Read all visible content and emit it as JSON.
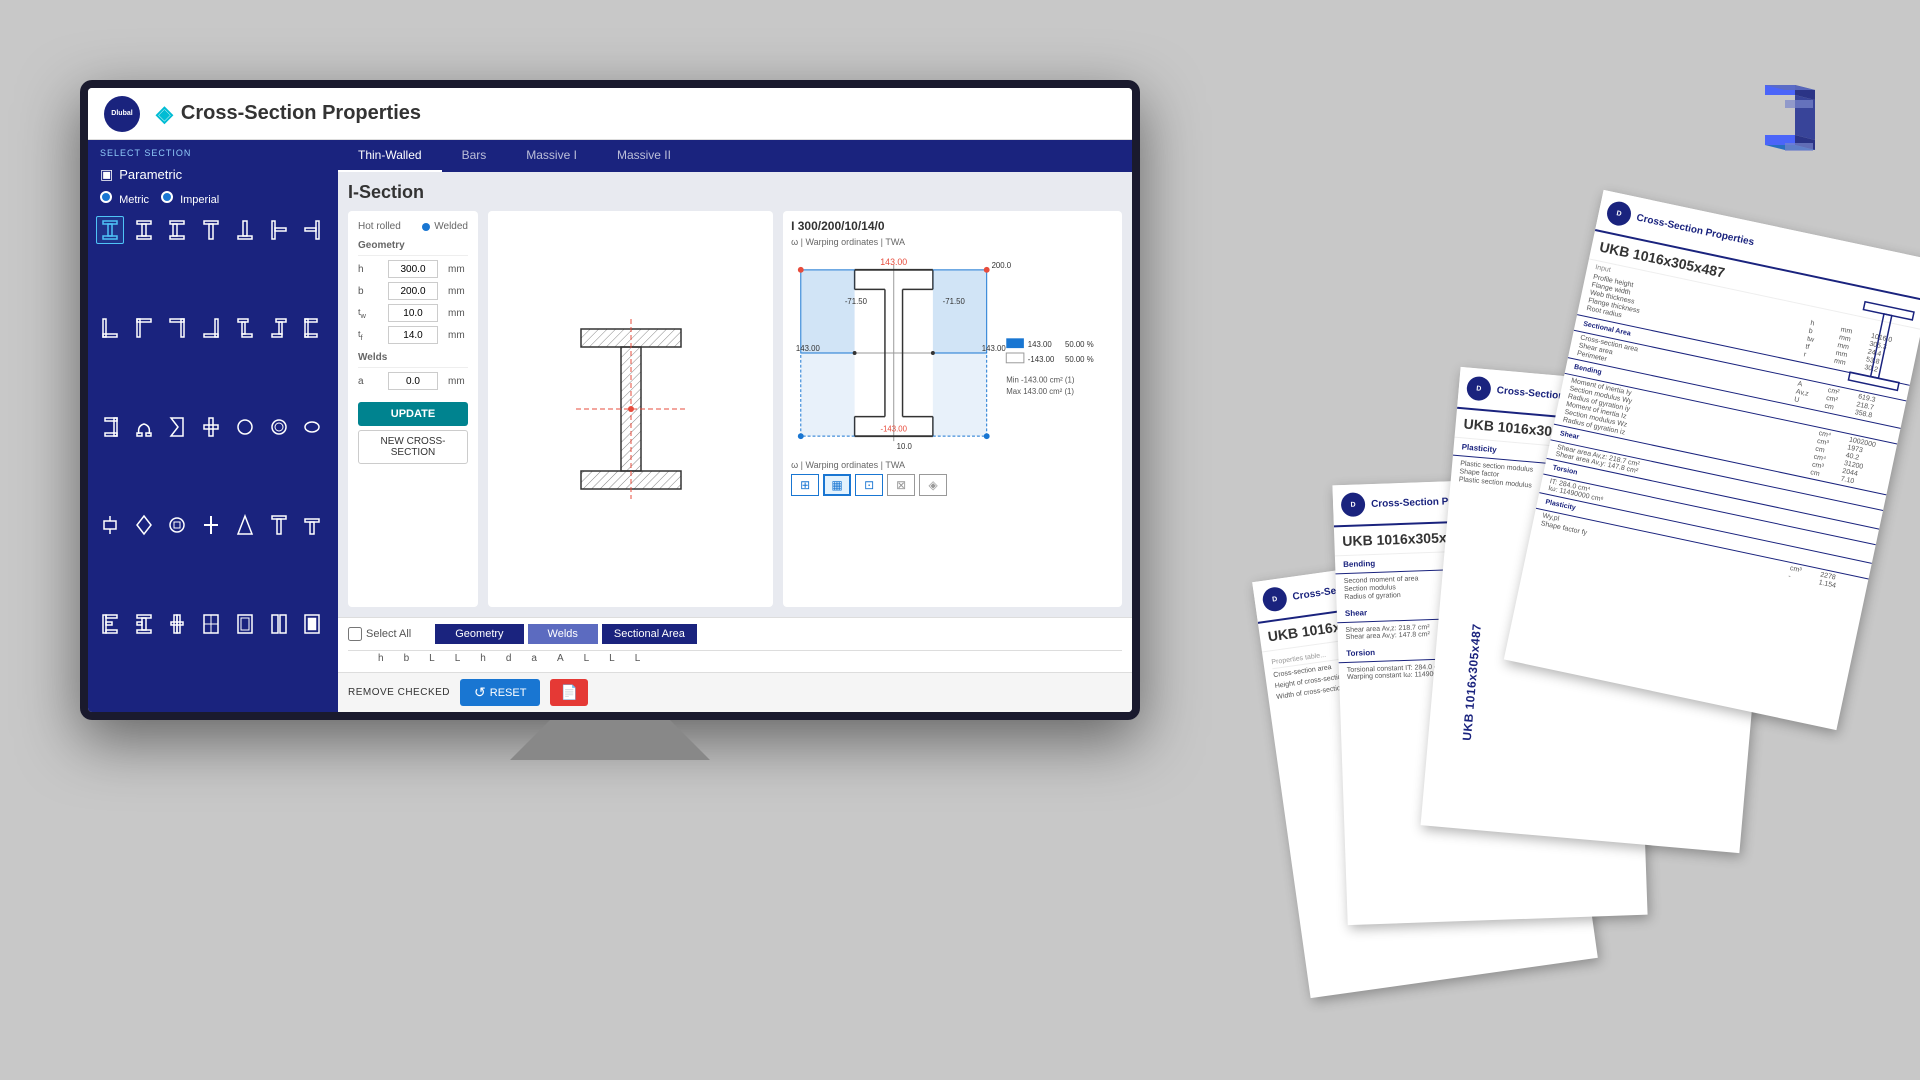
{
  "app": {
    "title": "Cross-Section Properties",
    "logo_text": "Dlubal"
  },
  "header": {
    "title": "Cross-Section Properties"
  },
  "sidebar": {
    "section_label": "SELECT SECTION",
    "parametric_label": "Parametric",
    "metric_label": "Metric",
    "imperial_label": "Imperial",
    "shapes": [
      "I",
      "I",
      "I",
      "I",
      "T",
      "T",
      "T",
      "T",
      "T",
      "T",
      "T",
      "T",
      "T",
      "⌐",
      "Z",
      "C",
      "C",
      "Ω",
      "Σ",
      "C",
      "T",
      "T",
      "T",
      "T",
      "T",
      "T",
      "T",
      "T",
      "T",
      "T",
      "T",
      "T",
      "T",
      "T",
      "T",
      "T",
      "T",
      "T",
      "T",
      "T",
      "T",
      "T",
      "T",
      "T",
      "T",
      "T",
      "T",
      "T",
      "T"
    ]
  },
  "nav": {
    "tabs": [
      "Thin-Walled",
      "Bars",
      "Massive I",
      "Massive II"
    ]
  },
  "section": {
    "title": "I-Section",
    "hot_rolled": "Hot rolled",
    "welded": "Welded",
    "geometry_label": "Geometry",
    "params": [
      {
        "name": "h",
        "value": "300.0",
        "unit": "mm"
      },
      {
        "name": "b",
        "value": "200.0",
        "unit": "mm"
      },
      {
        "name": "tw",
        "value": "10.0",
        "unit": "mm"
      },
      {
        "name": "tf",
        "value": "14.0",
        "unit": "mm"
      }
    ],
    "welds_label": "Welds",
    "weld_param": {
      "name": "a",
      "value": "0.0",
      "unit": "mm"
    },
    "update_btn": "UPDATE",
    "new_section_btn": "NEW CROSS-SECTION"
  },
  "diagram": {
    "title": "I 300/200/10/14/0",
    "subtitle": "ω | Warping ordinates | TWA",
    "values": {
      "top": "143.00",
      "right": "200.0",
      "neg_top": "-71.50",
      "pos_y": "143.00",
      "neg_y": "-143.00",
      "bottom_val": "10.0",
      "right_val1": "-71.50",
      "min_label": "Min",
      "max_label": "Max",
      "min_val": "-143.00 cm²",
      "max_val": "143.00 cm²",
      "min_loc": "(1)",
      "max_loc": "(1)"
    },
    "legend": {
      "val1": "143.00",
      "pct1": "50.00 %",
      "val2": "-143.00",
      "pct2": "50.00 %"
    }
  },
  "bottom_table": {
    "select_all": "Select All",
    "tabs": [
      "Geometry",
      "Welds",
      "Sectional Area"
    ],
    "columns": [
      "h",
      "b",
      "L",
      "L",
      "h",
      "d",
      "a",
      "A",
      "L",
      "L",
      "L"
    ]
  },
  "action_bar": {
    "remove_checked": "REMOVE CHECKED",
    "reset": "RESET",
    "pdf": "PDF"
  },
  "report": {
    "title": "Cross-Section Properties",
    "section_name": "UKB 1016x305x487",
    "logo": "Dlubal"
  }
}
